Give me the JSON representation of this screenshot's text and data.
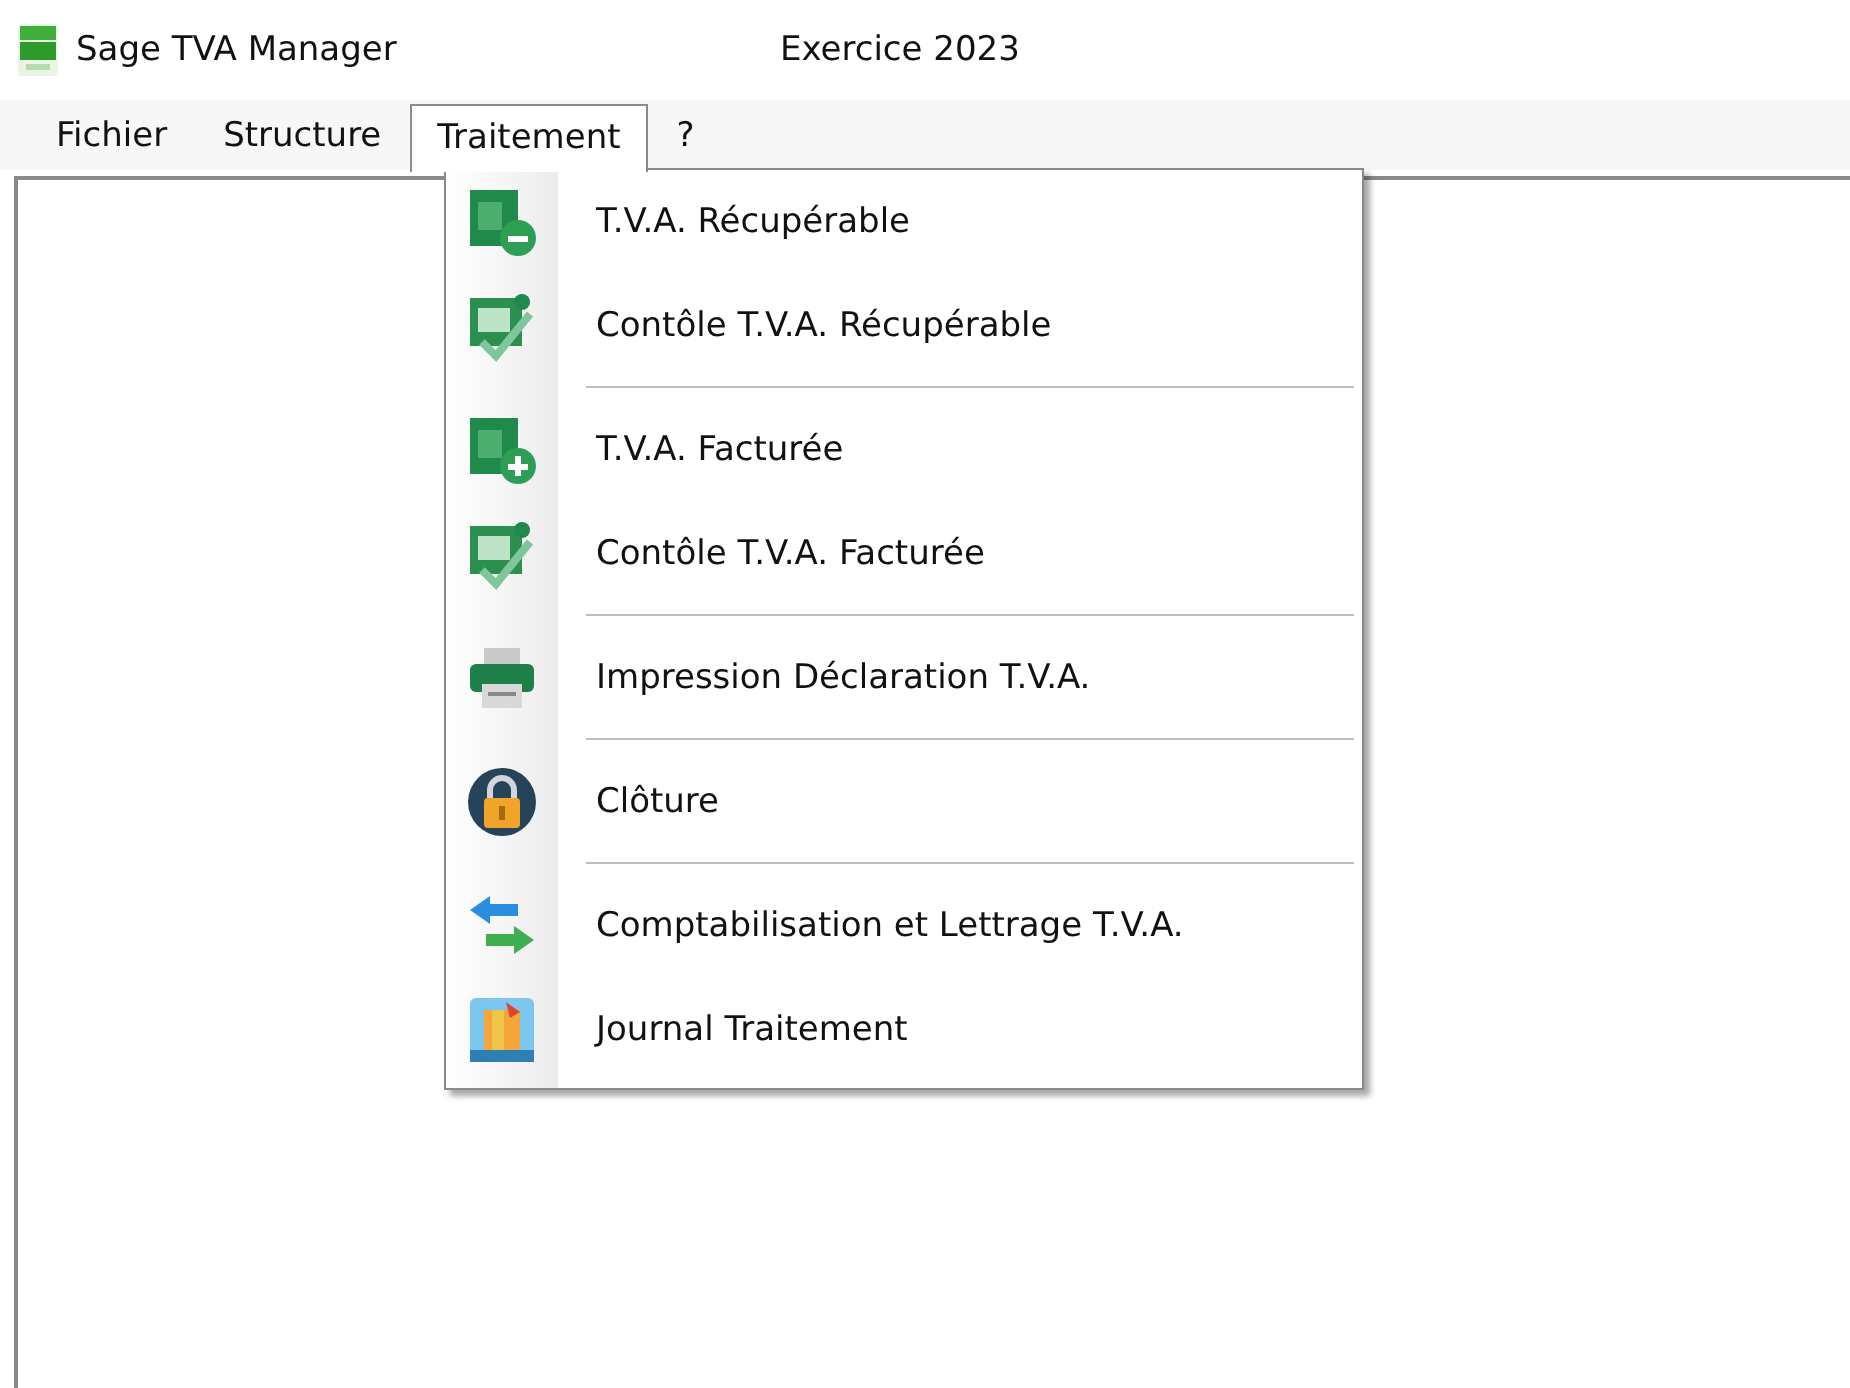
{
  "window": {
    "title": "Sage TVA Manager",
    "subtitle": "Exercice 2023"
  },
  "menu_bar": [
    {
      "label": "Fichier",
      "selected": false
    },
    {
      "label": "Structure",
      "selected": false
    },
    {
      "label": "Traitement",
      "selected": true
    },
    {
      "label": "?",
      "selected": false
    }
  ],
  "dropdown": [
    {
      "kind": "item",
      "label": "T.V.A. Récupérable"
    },
    {
      "kind": "item",
      "label": "Contôle T.V.A. Récupérable"
    },
    {
      "kind": "separator"
    },
    {
      "kind": "item",
      "label": "T.V.A. Facturée"
    },
    {
      "kind": "item",
      "label": "Contôle T.V.A. Facturée"
    },
    {
      "kind": "separator"
    },
    {
      "kind": "item",
      "label": "Impression Déclaration T.V.A."
    },
    {
      "kind": "separator"
    },
    {
      "kind": "item",
      "label": "Clôture"
    },
    {
      "kind": "separator"
    },
    {
      "kind": "item",
      "label": "Comptabilisation et Lettrage T.V.A."
    },
    {
      "kind": "item",
      "label": "Journal Traitement"
    }
  ]
}
